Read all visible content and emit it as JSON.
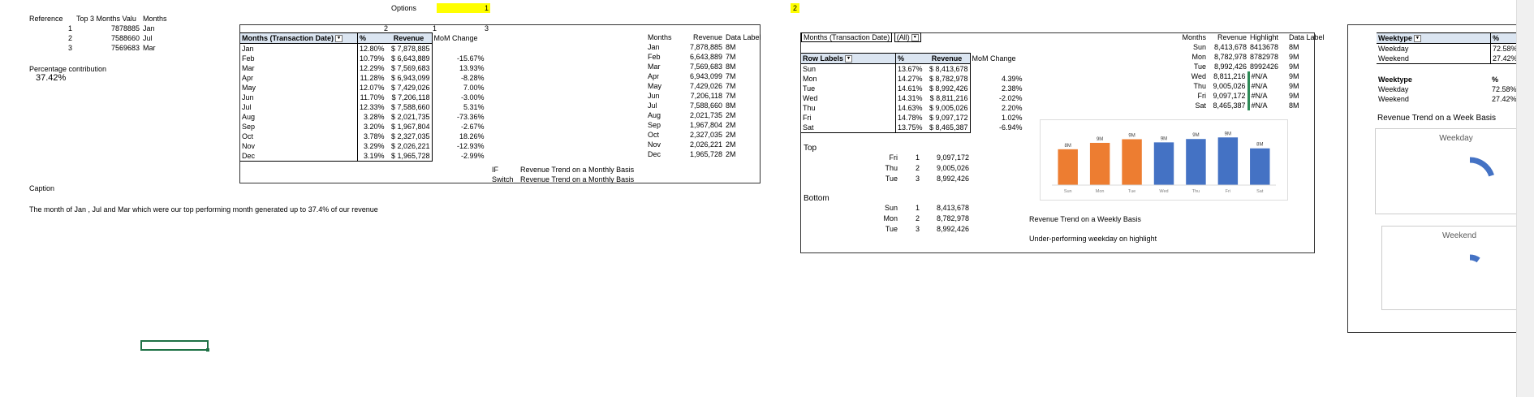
{
  "options": {
    "label": "Options",
    "value1": "1",
    "value2": "2"
  },
  "reference": {
    "headers": [
      "Reference",
      "Top 3 Months Valu",
      "Months"
    ],
    "rows": [
      {
        "ref": "1",
        "value": "7878885",
        "month": "Jan"
      },
      {
        "ref": "2",
        "value": "7588660",
        "month": "Jul"
      },
      {
        "ref": "3",
        "value": "7569683",
        "month": "Mar"
      }
    ]
  },
  "percentage": {
    "label": "Percentage contribution",
    "value": "37.42%"
  },
  "caption": {
    "label": "Caption",
    "text": "The month of Jan , Jul and Mar which were our top performing month generated up to 37.4% of our revenue"
  },
  "monthly_pivot": {
    "col_nums": [
      "2",
      "1",
      "3"
    ],
    "header": "Months (Transaction Date)",
    "pct_header": "%",
    "rev_header": "Revenue",
    "mom_header": "MoM Change",
    "rows": [
      {
        "m": "Jan",
        "pct": "12.80%",
        "rev": "$ 7,878,885",
        "mom": ""
      },
      {
        "m": "Feb",
        "pct": "10.79%",
        "rev": "$ 6,643,889",
        "mom": "-15.67%"
      },
      {
        "m": "Mar",
        "pct": "12.29%",
        "rev": "$ 7,569,683",
        "mom": "13.93%"
      },
      {
        "m": "Apr",
        "pct": "11.28%",
        "rev": "$ 6,943,099",
        "mom": "-8.28%"
      },
      {
        "m": "May",
        "pct": "12.07%",
        "rev": "$ 7,429,026",
        "mom": "7.00%"
      },
      {
        "m": "Jun",
        "pct": "11.70%",
        "rev": "$ 7,206,118",
        "mom": "-3.00%"
      },
      {
        "m": "Jul",
        "pct": "12.33%",
        "rev": "$ 7,588,660",
        "mom": "5.31%"
      },
      {
        "m": "Aug",
        "pct": "3.28%",
        "rev": "$ 2,021,735",
        "mom": "-73.36%"
      },
      {
        "m": "Sep",
        "pct": "3.20%",
        "rev": "$ 1,967,804",
        "mom": "-2.67%"
      },
      {
        "m": "Oct",
        "pct": "3.78%",
        "rev": "$ 2,327,035",
        "mom": "18.26%"
      },
      {
        "m": "Nov",
        "pct": "3.29%",
        "rev": "$ 2,026,221",
        "mom": "-12.93%"
      },
      {
        "m": "Dec",
        "pct": "3.19%",
        "rev": "$ 1,965,728",
        "mom": "-2.99%"
      }
    ],
    "if_label": "IF",
    "if_text": "Revenue Trend on a Monthly Basis",
    "switch_label": "Switch",
    "switch_text": "Revenue Trend on a Monthly Basis"
  },
  "monthly_labels": {
    "headers": [
      "Months",
      "Revenue",
      "Data Label"
    ],
    "rows": [
      [
        "Jan",
        "7,878,885",
        "8M"
      ],
      [
        "Feb",
        "6,643,889",
        "7M"
      ],
      [
        "Mar",
        "7,569,683",
        "8M"
      ],
      [
        "Apr",
        "6,943,099",
        "7M"
      ],
      [
        "May",
        "7,429,026",
        "7M"
      ],
      [
        "Jun",
        "7,206,118",
        "7M"
      ],
      [
        "Jul",
        "7,588,660",
        "8M"
      ],
      [
        "Aug",
        "2,021,735",
        "2M"
      ],
      [
        "Sep",
        "1,967,804",
        "2M"
      ],
      [
        "Oct",
        "2,327,035",
        "2M"
      ],
      [
        "Nov",
        "2,026,221",
        "2M"
      ],
      [
        "Dec",
        "1,965,728",
        "2M"
      ]
    ]
  },
  "weekly_pivot": {
    "filter_label": "Months (Transaction Date)",
    "filter_value": "(All)",
    "row_labels": "Row Labels",
    "pct_header": "%",
    "rev_header": "Revenue",
    "mom_header": "MoM Change",
    "rows": [
      {
        "d": "Sun",
        "pct": "13.67%",
        "rev": "$ 8,413,678",
        "mom": ""
      },
      {
        "d": "Mon",
        "pct": "14.27%",
        "rev": "$ 8,782,978",
        "mom": "4.39%"
      },
      {
        "d": "Tue",
        "pct": "14.61%",
        "rev": "$ 8,992,426",
        "mom": "2.38%"
      },
      {
        "d": "Wed",
        "pct": "14.31%",
        "rev": "$ 8,811,216",
        "mom": "-2.02%"
      },
      {
        "d": "Thu",
        "pct": "14.63%",
        "rev": "$ 9,005,026",
        "mom": "2.20%"
      },
      {
        "d": "Fri",
        "pct": "14.78%",
        "rev": "$ 9,097,172",
        "mom": "1.02%"
      },
      {
        "d": "Sat",
        "pct": "13.75%",
        "rev": "$ 8,465,387",
        "mom": "-6.94%"
      }
    ]
  },
  "weekly_labels": {
    "headers": [
      "Months",
      "Revenue",
      "Highlight",
      "Data Label"
    ],
    "rows": [
      [
        "Sun",
        "8,413,678",
        "8413678",
        "8M"
      ],
      [
        "Mon",
        "8,782,978",
        "8782978",
        "9M"
      ],
      [
        "Tue",
        "8,992,426",
        "8992426",
        "9M"
      ],
      [
        "Wed",
        "8,811,216",
        "#N/A",
        "9M"
      ],
      [
        "Thu",
        "9,005,026",
        "#N/A",
        "9M"
      ],
      [
        "Fri",
        "9,097,172",
        "#N/A",
        "9M"
      ],
      [
        "Sat",
        "8,465,387",
        "#N/A",
        "8M"
      ]
    ]
  },
  "top": {
    "label": "Top",
    "rows": [
      [
        "Fri",
        "1",
        "9,097,172"
      ],
      [
        "Thu",
        "2",
        "9,005,026"
      ],
      [
        "Tue",
        "3",
        "8,992,426"
      ]
    ]
  },
  "bottom": {
    "label": "Bottom",
    "rows": [
      [
        "Sun",
        "1",
        "8,413,678"
      ],
      [
        "Mon",
        "2",
        "8,782,978"
      ],
      [
        "Tue",
        "3",
        "8,992,426"
      ]
    ]
  },
  "weekly_notes": {
    "title": "Revenue Trend on a Weekly Basis",
    "subtitle": "Under-performing weekday on highlight"
  },
  "chart_data": {
    "type": "bar",
    "categories": [
      "Sun",
      "Mon",
      "Tue",
      "Wed",
      "Thu",
      "Fri",
      "Sat"
    ],
    "values": [
      8413678,
      8782978,
      8992426,
      8811216,
      9005026,
      9097172,
      8465387
    ],
    "data_labels": [
      "8M",
      "9M",
      "9M",
      "9M",
      "9M",
      "9M",
      "8M"
    ],
    "highlighted": [
      true,
      true,
      true,
      false,
      false,
      false,
      false
    ],
    "colors": {
      "highlight": "#ed7d31",
      "normal": "#4472c4"
    },
    "title": "",
    "xlabel": "",
    "ylabel": "",
    "ylim": [
      0,
      10000000
    ],
    "grid": false
  },
  "weektype": {
    "header": "Weektype",
    "pct_header": "%",
    "rows": [
      [
        "Weekday",
        "72.58%"
      ],
      [
        "Weekend",
        "27.42%"
      ]
    ],
    "rows2": [
      [
        "Weekday",
        "72.58%"
      ],
      [
        "Weekend",
        "27.42%"
      ]
    ],
    "trend_title": "Revenue Trend on a Week Basis",
    "donut1": {
      "title": "Weekday",
      "fraction": 0.2
    },
    "donut2": {
      "title": "Weekend",
      "fraction": 0.1
    },
    "color": "#4472c4"
  }
}
